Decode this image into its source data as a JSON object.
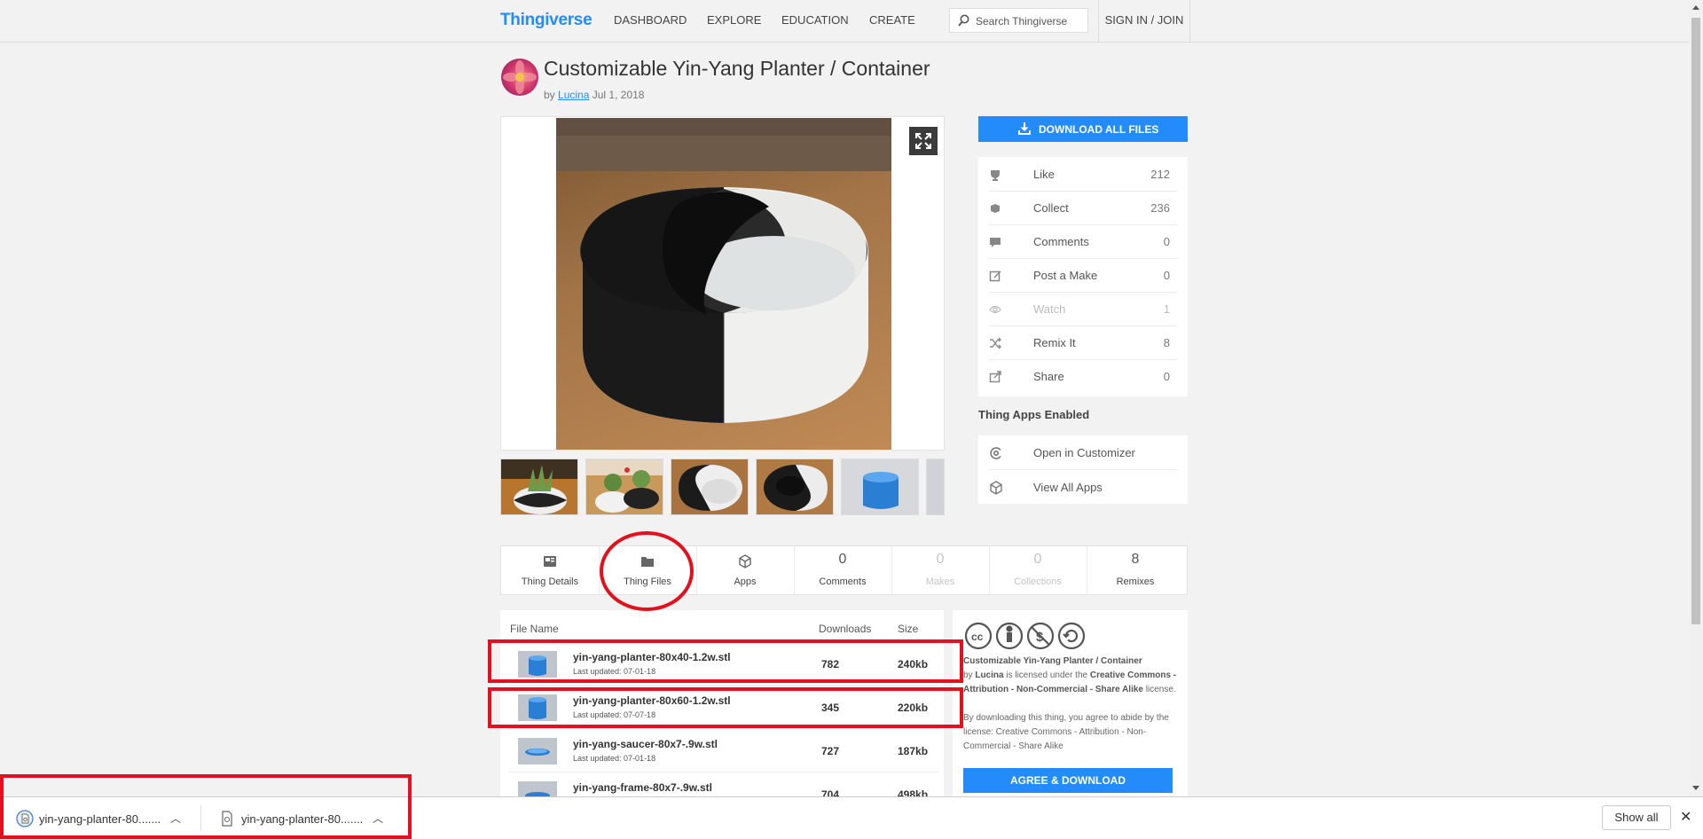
{
  "nav": {
    "logo": "Thingiverse",
    "items": [
      "DASHBOARD",
      "EXPLORE",
      "EDUCATION",
      "CREATE"
    ],
    "search_placeholder": "Search Thingiverse",
    "signin": "SIGN IN / JOIN"
  },
  "thing": {
    "title": "Customizable Yin-Yang Planter / Container",
    "by": "by",
    "author": "Lucina",
    "date": "Jul 1, 2018"
  },
  "download_all": "DOWNLOAD ALL FILES",
  "stats": [
    {
      "label": "Like",
      "value": "212",
      "icon": "trophy-icon"
    },
    {
      "label": "Collect",
      "value": "236",
      "icon": "collect-icon"
    },
    {
      "label": "Comments",
      "value": "0",
      "icon": "comment-icon"
    },
    {
      "label": "Post a Make",
      "value": "0",
      "icon": "post-make-icon"
    },
    {
      "label": "Watch",
      "value": "1",
      "icon": "eye-icon",
      "dim": true
    },
    {
      "label": "Remix It",
      "value": "8",
      "icon": "shuffle-icon"
    },
    {
      "label": "Share",
      "value": "0",
      "icon": "share-icon"
    }
  ],
  "apps_title": "Thing Apps Enabled",
  "apps": [
    {
      "label": "Open in Customizer",
      "icon": "customizer-icon"
    },
    {
      "label": "View All Apps",
      "icon": "cube-icon"
    }
  ],
  "tabs": [
    {
      "label": "Thing Details",
      "value": "",
      "icon": "details-icon"
    },
    {
      "label": "Thing Files",
      "value": "",
      "icon": "folder-icon"
    },
    {
      "label": "Apps",
      "value": "",
      "icon": "cube-icon"
    },
    {
      "label": "Comments",
      "value": "0"
    },
    {
      "label": "Makes",
      "value": "0",
      "dim": true
    },
    {
      "label": "Collections",
      "value": "0",
      "dim": true
    },
    {
      "label": "Remixes",
      "value": "8"
    }
  ],
  "files": {
    "headers": {
      "name": "File Name",
      "downloads": "Downloads",
      "size": "Size"
    },
    "rows": [
      {
        "name": "yin-yang-planter-80x40-1.2w.stl",
        "updated": "Last updated: 07-01-18",
        "downloads": "782",
        "size": "240kb"
      },
      {
        "name": "yin-yang-planter-80x60-1.2w.stl",
        "updated": "Last updated: 07-07-18",
        "downloads": "345",
        "size": "220kb"
      },
      {
        "name": "yin-yang-saucer-80x7-.9w.stl",
        "updated": "Last updated: 07-01-18",
        "downloads": "727",
        "size": "187kb"
      },
      {
        "name": "yin-yang-frame-80x7-.9w.stl",
        "updated": "",
        "downloads": "704",
        "size": "498kb"
      }
    ]
  },
  "license": {
    "thing": "Customizable Yin-Yang Planter / Container",
    "by": "by",
    "author": "Lucina",
    "mid": "is licensed under the",
    "name": "Creative Commons - Attribution - Non-Commercial - Share Alike",
    "end": "license.",
    "note": "By downloading this thing, you agree to abide by the license: Creative Commons - Attribution - Non-Commercial - Share Alike",
    "agree": "AGREE & DOWNLOAD"
  },
  "downloads_bar": {
    "items": [
      "yin-yang-planter-80.......",
      "yin-yang-planter-80......."
    ],
    "show_all": "Show all",
    "close": "✕"
  },
  "colors": {
    "accent": "#248bfb",
    "annotation": "#e3101e"
  }
}
